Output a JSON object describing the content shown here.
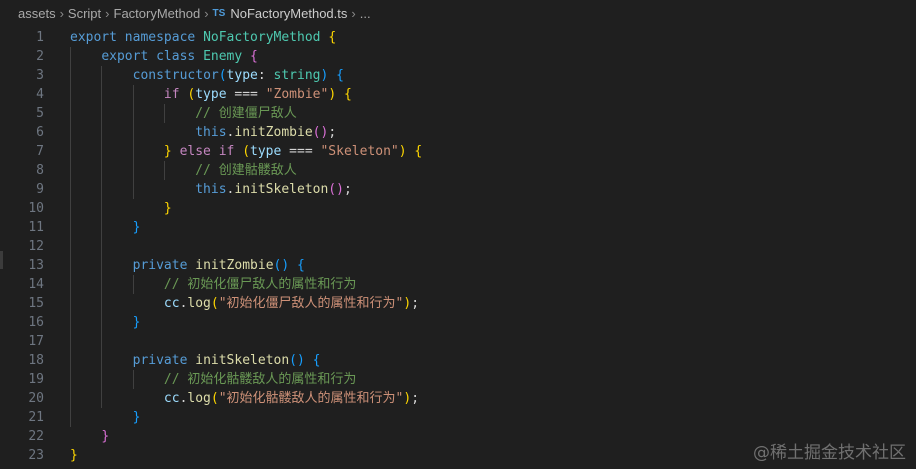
{
  "breadcrumb": {
    "items": [
      "assets",
      "Script",
      "FactoryMethod"
    ],
    "file_badge": "TS",
    "file": "NoFactoryMethod.ts",
    "tail": "..."
  },
  "editor": {
    "language": "TypeScript",
    "lines": [
      {
        "n": "1",
        "tokens": [
          [
            "kw",
            "export"
          ],
          [
            "plain",
            " "
          ],
          [
            "kw",
            "namespace"
          ],
          [
            "plain",
            " "
          ],
          [
            "cls",
            "NoFactoryMethod"
          ],
          [
            "plain",
            " "
          ],
          [
            "b1",
            "{"
          ]
        ]
      },
      {
        "n": "2",
        "tokens": [
          [
            "plain",
            "    "
          ],
          [
            "kw",
            "export"
          ],
          [
            "plain",
            " "
          ],
          [
            "kw",
            "class"
          ],
          [
            "plain",
            " "
          ],
          [
            "cls",
            "Enemy"
          ],
          [
            "plain",
            " "
          ],
          [
            "b2",
            "{"
          ]
        ]
      },
      {
        "n": "3",
        "tokens": [
          [
            "plain",
            "        "
          ],
          [
            "kw",
            "constructor"
          ],
          [
            "b3",
            "("
          ],
          [
            "var",
            "type"
          ],
          [
            "plain",
            ": "
          ],
          [
            "cls",
            "string"
          ],
          [
            "b3",
            ")"
          ],
          [
            "plain",
            " "
          ],
          [
            "b3",
            "{"
          ]
        ]
      },
      {
        "n": "4",
        "tokens": [
          [
            "plain",
            "            "
          ],
          [
            "ctl",
            "if"
          ],
          [
            "plain",
            " "
          ],
          [
            "b1",
            "("
          ],
          [
            "var",
            "type"
          ],
          [
            "plain",
            " === "
          ],
          [
            "str",
            "\"Zombie\""
          ],
          [
            "b1",
            ")"
          ],
          [
            "plain",
            " "
          ],
          [
            "b1",
            "{"
          ]
        ]
      },
      {
        "n": "5",
        "tokens": [
          [
            "plain",
            "                "
          ],
          [
            "cmt",
            "// 创建僵尸敌人"
          ]
        ]
      },
      {
        "n": "6",
        "tokens": [
          [
            "plain",
            "                "
          ],
          [
            "kw",
            "this"
          ],
          [
            "plain",
            "."
          ],
          [
            "fn",
            "initZombie"
          ],
          [
            "b2",
            "()"
          ],
          [
            "plain",
            ";"
          ]
        ]
      },
      {
        "n": "7",
        "tokens": [
          [
            "plain",
            "            "
          ],
          [
            "b1",
            "}"
          ],
          [
            "plain",
            " "
          ],
          [
            "ctl",
            "else"
          ],
          [
            "plain",
            " "
          ],
          [
            "ctl",
            "if"
          ],
          [
            "plain",
            " "
          ],
          [
            "b1",
            "("
          ],
          [
            "var",
            "type"
          ],
          [
            "plain",
            " === "
          ],
          [
            "str",
            "\"Skeleton\""
          ],
          [
            "b1",
            ")"
          ],
          [
            "plain",
            " "
          ],
          [
            "b1",
            "{"
          ]
        ]
      },
      {
        "n": "8",
        "tokens": [
          [
            "plain",
            "                "
          ],
          [
            "cmt",
            "// 创建骷髅敌人"
          ]
        ]
      },
      {
        "n": "9",
        "tokens": [
          [
            "plain",
            "                "
          ],
          [
            "kw",
            "this"
          ],
          [
            "plain",
            "."
          ],
          [
            "fn",
            "initSkeleton"
          ],
          [
            "b2",
            "()"
          ],
          [
            "plain",
            ";"
          ]
        ]
      },
      {
        "n": "10",
        "tokens": [
          [
            "plain",
            "            "
          ],
          [
            "b1",
            "}"
          ]
        ]
      },
      {
        "n": "11",
        "tokens": [
          [
            "plain",
            "        "
          ],
          [
            "b3",
            "}"
          ]
        ]
      },
      {
        "n": "12",
        "tokens": []
      },
      {
        "n": "13",
        "tokens": [
          [
            "plain",
            "        "
          ],
          [
            "kw",
            "private"
          ],
          [
            "plain",
            " "
          ],
          [
            "fn",
            "initZombie"
          ],
          [
            "b3",
            "()"
          ],
          [
            "plain",
            " "
          ],
          [
            "b3",
            "{"
          ]
        ]
      },
      {
        "n": "14",
        "tokens": [
          [
            "plain",
            "            "
          ],
          [
            "cmt",
            "// 初始化僵尸敌人的属性和行为"
          ]
        ]
      },
      {
        "n": "15",
        "tokens": [
          [
            "plain",
            "            "
          ],
          [
            "var",
            "cc"
          ],
          [
            "plain",
            "."
          ],
          [
            "fn",
            "log"
          ],
          [
            "b1",
            "("
          ],
          [
            "str",
            "\"初始化僵尸敌人的属性和行为\""
          ],
          [
            "b1",
            ")"
          ],
          [
            "plain",
            ";"
          ]
        ]
      },
      {
        "n": "16",
        "tokens": [
          [
            "plain",
            "        "
          ],
          [
            "b3",
            "}"
          ]
        ]
      },
      {
        "n": "17",
        "tokens": []
      },
      {
        "n": "18",
        "tokens": [
          [
            "plain",
            "        "
          ],
          [
            "kw",
            "private"
          ],
          [
            "plain",
            " "
          ],
          [
            "fn",
            "initSkeleton"
          ],
          [
            "b3",
            "()"
          ],
          [
            "plain",
            " "
          ],
          [
            "b3",
            "{"
          ]
        ]
      },
      {
        "n": "19",
        "tokens": [
          [
            "plain",
            "            "
          ],
          [
            "cmt",
            "// 初始化骷髅敌人的属性和行为"
          ]
        ]
      },
      {
        "n": "20",
        "tokens": [
          [
            "plain",
            "            "
          ],
          [
            "var",
            "cc"
          ],
          [
            "plain",
            "."
          ],
          [
            "fn",
            "log"
          ],
          [
            "b1",
            "("
          ],
          [
            "str",
            "\"初始化骷髅敌人的属性和行为\""
          ],
          [
            "b1",
            ")"
          ],
          [
            "plain",
            ";"
          ]
        ]
      },
      {
        "n": "21",
        "tokens": [
          [
            "plain",
            "        "
          ],
          [
            "b3",
            "}"
          ]
        ]
      },
      {
        "n": "22",
        "tokens": [
          [
            "plain",
            "    "
          ],
          [
            "b2",
            "}"
          ]
        ]
      },
      {
        "n": "23",
        "tokens": [
          [
            "b1",
            "}"
          ]
        ]
      }
    ]
  },
  "watermark": "@稀土掘金技术社区"
}
